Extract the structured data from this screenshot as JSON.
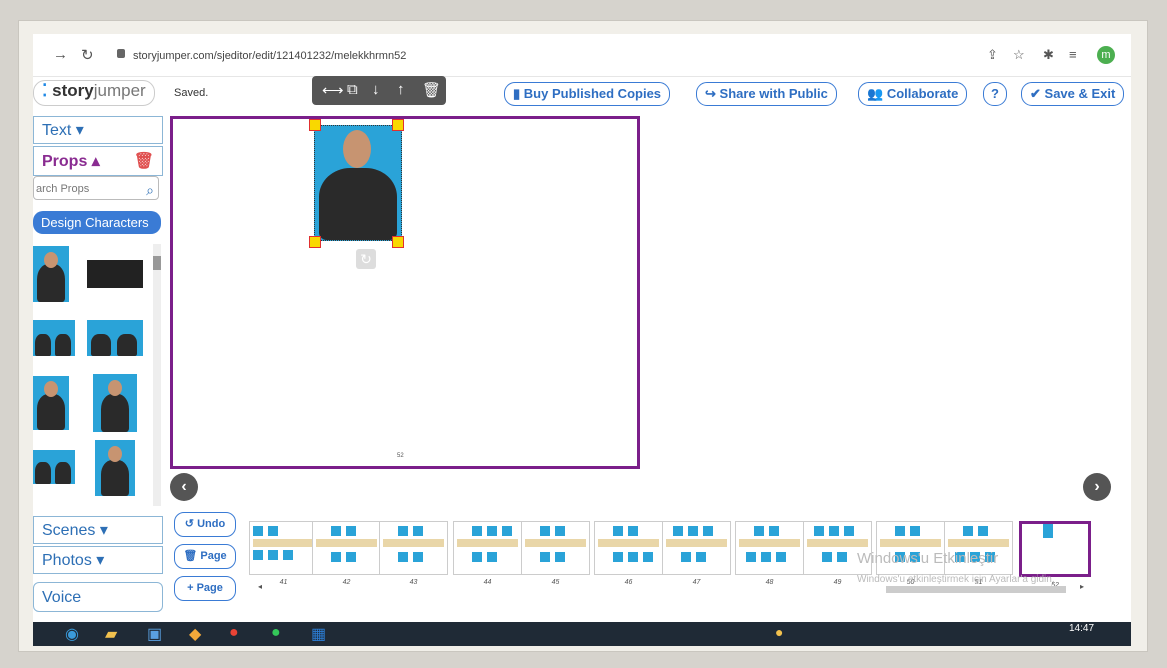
{
  "browser": {
    "url": "storyjumper.com/sjeditor/edit/121401232/melekkhrmn52",
    "avatar_letter": "m"
  },
  "header": {
    "logo_story": "story",
    "logo_jumper": "jumper",
    "saved_status": "Saved.",
    "buttons": {
      "buy": "Buy Published Copies",
      "share": "Share with Public",
      "collaborate": "Collaborate",
      "help": "?",
      "save_exit": "Save & Exit"
    }
  },
  "sidebar": {
    "text": "Text",
    "props": "Props",
    "search_placeholder": "arch Props",
    "design_characters": "Design Characters",
    "scenes": "Scenes",
    "photos": "Photos",
    "voice": "Voice"
  },
  "canvas": {
    "page_number": "52"
  },
  "controls": {
    "undo": "Undo",
    "delete_page": "Page",
    "add_page": "Page"
  },
  "pages": [
    "41",
    "42",
    "43",
    "44",
    "45",
    "46",
    "47",
    "48",
    "49",
    "50",
    "51",
    "52"
  ],
  "watermark": {
    "line1": "Windows'u Etkinleştir",
    "line2": "Windows'u etkinleştirmek için Ayarlar'a gidin."
  },
  "taskbar": {
    "clock": "14:47"
  },
  "colors": {
    "accent": "#3a7bd5",
    "selection": "#7b1f8a",
    "photo_bg": "#2aa3d8"
  }
}
